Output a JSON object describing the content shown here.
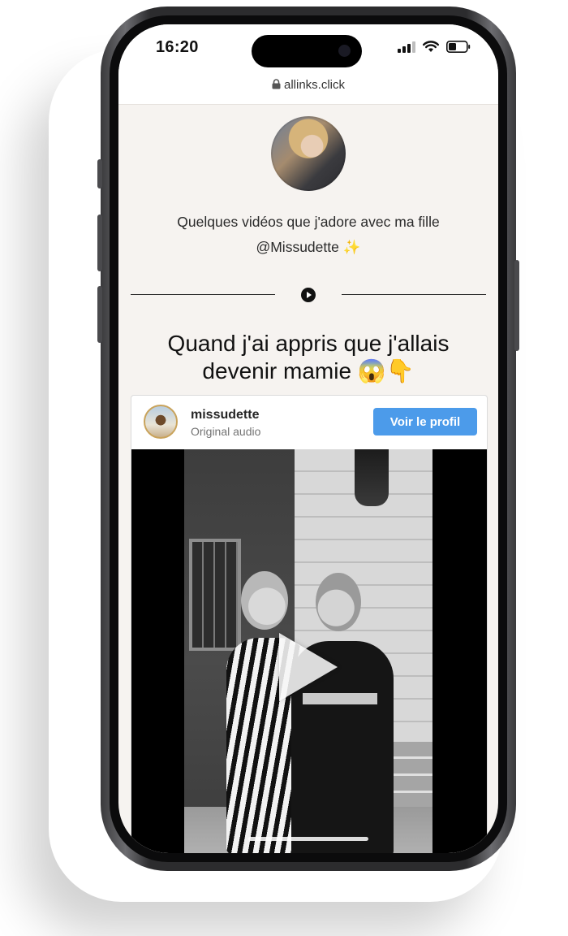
{
  "status_bar": {
    "time": "16:20"
  },
  "browser": {
    "url": "allinks.click"
  },
  "profile": {
    "bio_line1": "Quelques vidéos que j'adore avec ma fille",
    "bio_line2": "@Missudette ✨"
  },
  "section": {
    "heading_line1": "Quand j'ai appris que j'allais",
    "heading_line2": "devenir mamie 😱👇"
  },
  "embed": {
    "username": "missudette",
    "subtitle": "Original audio",
    "button_label": "Voir le profil"
  },
  "colors": {
    "page_bg": "#f6f3f0",
    "button_blue": "#4c9bea",
    "divider": "#2a2a2a"
  }
}
